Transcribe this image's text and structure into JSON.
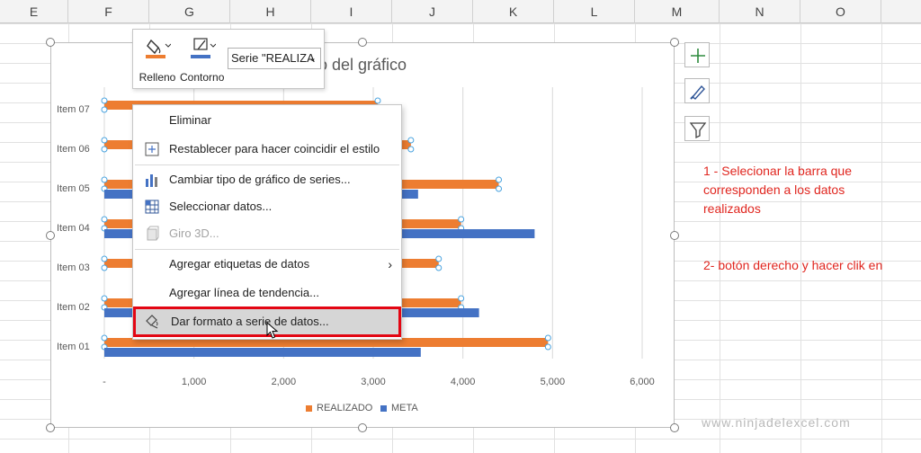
{
  "columns": [
    "E",
    "F",
    "G",
    "H",
    "I",
    "J",
    "K",
    "L",
    "M",
    "N",
    "O"
  ],
  "format_bar": {
    "fill_label": "Relleno",
    "outline_label": "Contorno",
    "series_select": "Serie \"REALIZA",
    "fill_color": "#ed7d31",
    "outline_color": "#4472c4"
  },
  "chart": {
    "title_partial": "ulo del gráfico"
  },
  "chart_data": {
    "type": "bar",
    "orientation": "horizontal",
    "categories": [
      "Item 01",
      "Item 02",
      "Item 03",
      "Item 04",
      "Item 05",
      "Item 06",
      "Item 07"
    ],
    "series": [
      {
        "name": "REALIZADO",
        "color": "#ed7d31",
        "values": [
          4950,
          3980,
          3730,
          3980,
          4400,
          3420,
          3050
        ]
      },
      {
        "name": "META",
        "color": "#4472c4",
        "values": [
          3530,
          4180,
          null,
          4800,
          3500,
          null,
          null
        ]
      }
    ],
    "x_ticks": [
      "-",
      "1,000",
      "2,000",
      "3,000",
      "4,000",
      "5,000",
      "6,000"
    ],
    "xlim": [
      0,
      6000
    ],
    "grid": true,
    "legend_position": "bottom"
  },
  "context_menu": {
    "items": [
      {
        "label": "Eliminar",
        "icon": "none",
        "disabled": false
      },
      {
        "label": "Restablecer para hacer coincidir el estilo",
        "icon": "reset-style-icon",
        "disabled": false
      },
      {
        "label": "Cambiar tipo de gráfico de series...",
        "icon": "change-chart-type-icon",
        "disabled": false
      },
      {
        "label": "Seleccionar datos...",
        "icon": "select-data-icon",
        "disabled": false
      },
      {
        "label": "Giro 3D...",
        "icon": "rotation-3d-icon",
        "disabled": true
      },
      {
        "label": "Agregar etiquetas de datos",
        "icon": "none",
        "disabled": false,
        "submenu": true
      },
      {
        "label": "Agregar línea de tendencia...",
        "icon": "none",
        "disabled": false
      },
      {
        "label": "Dar formato a serie de datos...",
        "icon": "format-series-icon",
        "disabled": false,
        "highlighted": true
      }
    ]
  },
  "annotations": {
    "step1_lines": [
      "1 - Selecionar la barra que",
      "corresponden a los datos",
      "realizados"
    ],
    "step2": "2- botón derecho y hacer clik en"
  },
  "watermark": "www.ninjadelexcel.com"
}
